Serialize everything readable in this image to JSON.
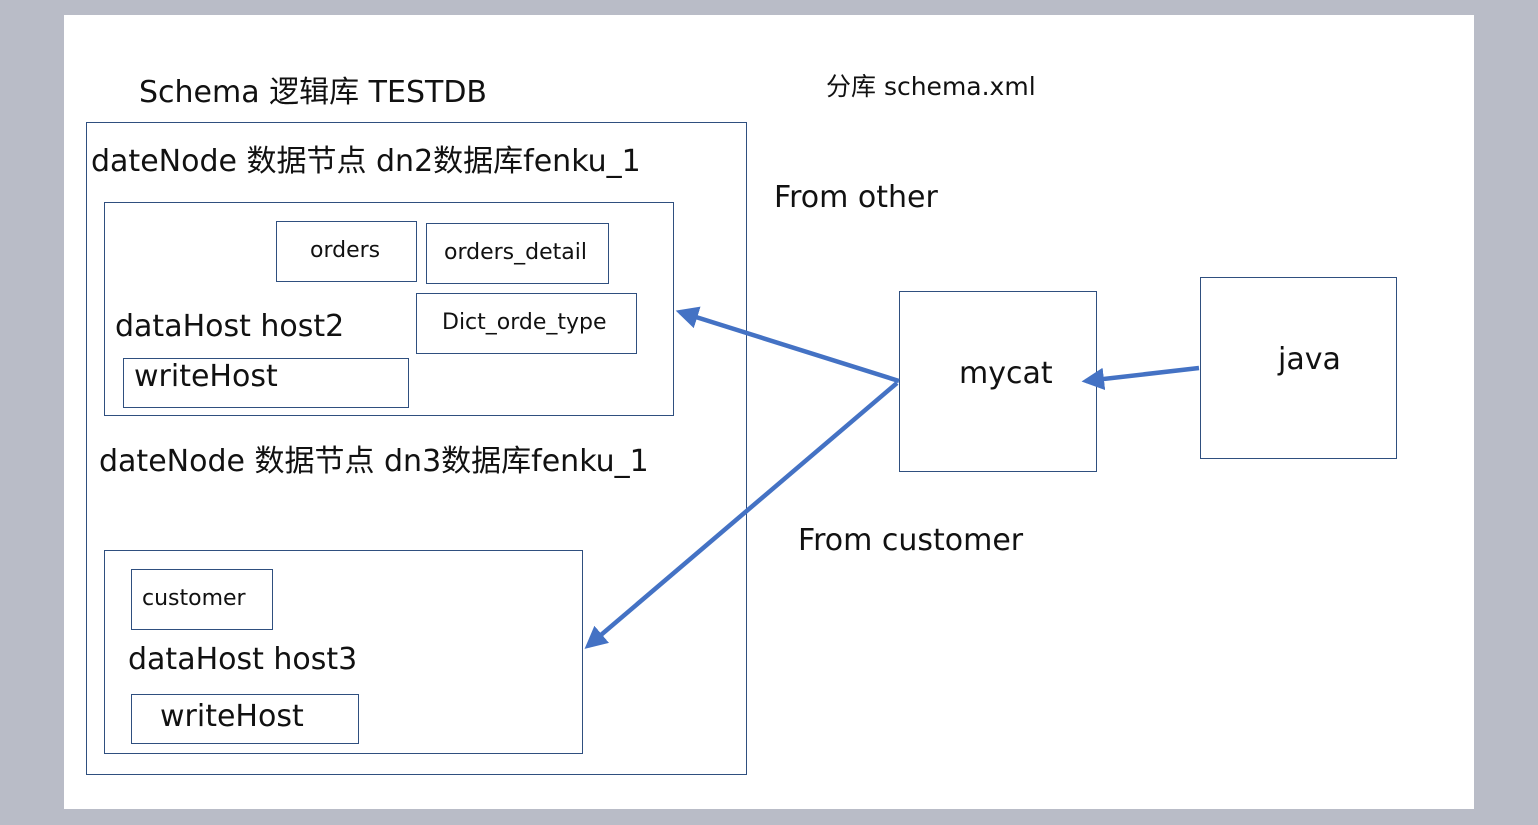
{
  "title_left": "Schema 逻辑库 TESTDB",
  "title_right": "分库 schema.xml",
  "schema": {
    "node1_label": "dateNode 数据节点 dn2数据库fenku_1",
    "node2_label": "dateNode 数据节点 dn3数据库fenku_1",
    "host2": {
      "label": "dataHost host2",
      "tables": [
        "orders",
        "orders_detail",
        "Dict_orde_type"
      ],
      "write_host": "writeHost"
    },
    "host3": {
      "label": "dataHost host3",
      "tables": [
        "customer"
      ],
      "write_host": "writeHost"
    }
  },
  "mycat": "mycat",
  "java": "java",
  "from_other": "From other",
  "from_customer": "From customer",
  "colors": {
    "arrow": "#4472c4",
    "border": "#2f4f7f",
    "background": "#b9bcc7"
  }
}
